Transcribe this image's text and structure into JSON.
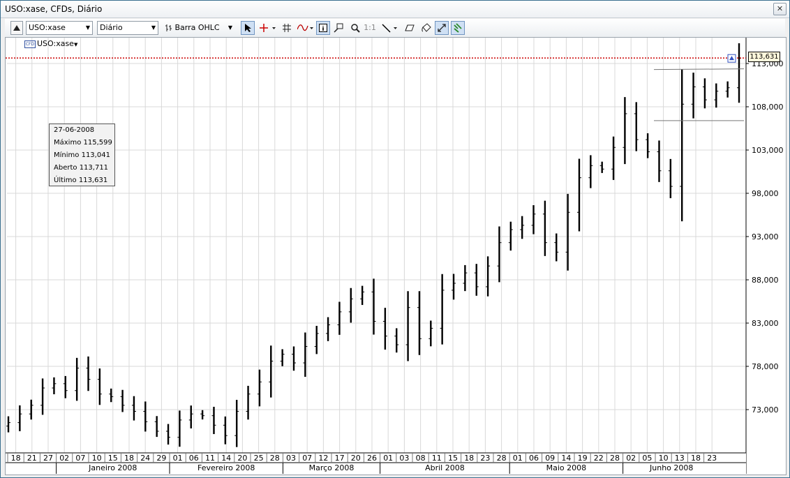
{
  "window": {
    "title": "USO:xase, CFDs, Diário",
    "close_glyph": "✕"
  },
  "toolbar": {
    "symbol_value": "USO:xase",
    "period_value": "Diário",
    "chart_type_value": "Barra OHLC",
    "zoom_ratio_label": "1:1",
    "icons": [
      "panel-toggle-icon",
      "bar-chart-icon",
      "cursor-icon",
      "crosshair-icon",
      "grid-icon",
      "indicator-icon",
      "info-icon",
      "zoom-box-icon",
      "zoom-icon",
      "line-tool-icon",
      "eraser-icon",
      "paint-icon",
      "auto-scale-icon",
      "link-icon"
    ]
  },
  "symbol_label": {
    "badge": "CFD",
    "text": "USO:xase"
  },
  "tooltip": {
    "date": "27-06-2008",
    "rows": [
      {
        "label": "Máximo",
        "value": "115,599"
      },
      {
        "label": "Mínimo",
        "value": "113,041"
      },
      {
        "label": "Aberto",
        "value": "113,711"
      },
      {
        "label": "Último",
        "value": "113,631"
      }
    ]
  },
  "price_tag": "113,631",
  "colors": {
    "bars": "#000000",
    "grid": "#d8d8d8",
    "price_line": "#cc0000",
    "tag_bg": "#fff8dc"
  },
  "chart_data": {
    "type": "ohlc",
    "title": "",
    "ylim": [
      68000,
      117000
    ],
    "y_ticks": [
      "73,000",
      "78,000",
      "83,000",
      "88,000",
      "93,000",
      "98,000",
      "103,000",
      "108,000",
      "113,000"
    ],
    "y_tick_values": [
      73000,
      78000,
      83000,
      88000,
      93000,
      98000,
      103000,
      108000,
      113000
    ],
    "last_price": 113631,
    "day_labels": [
      "18",
      "21",
      "27",
      "02",
      "07",
      "10",
      "15",
      "18",
      "24",
      "29",
      "01",
      "06",
      "11",
      "14",
      "20",
      "25",
      "28",
      "03",
      "07",
      "12",
      "17",
      "20",
      "26",
      "01",
      "03",
      "08",
      "11",
      "15",
      "18",
      "23",
      "28",
      "01",
      "06",
      "09",
      "14",
      "19",
      "22",
      "28",
      "02",
      "05",
      "10",
      "13",
      "18",
      "23"
    ],
    "months": [
      {
        "name": "Janeiro 2008",
        "start": 3,
        "end": 10
      },
      {
        "name": "Fevereiro 2008",
        "start": 10,
        "end": 17
      },
      {
        "name": "Março 2008",
        "start": 17,
        "end": 23
      },
      {
        "name": "Abril 2008",
        "start": 23,
        "end": 31
      },
      {
        "name": "Maio 2008",
        "start": 31,
        "end": 38
      },
      {
        "name": "Junho 2008",
        "start": 38,
        "end": 44
      }
    ],
    "close_series": [
      71.5,
      72.5,
      73.5,
      75.5,
      76,
      75.2,
      77.8,
      76.5,
      74.8,
      74.5,
      73.5,
      72.8,
      71.6,
      70.5,
      69.8,
      71.8,
      72.5,
      72.3,
      71.2,
      70,
      72.8,
      74.8,
      76.2,
      78.6,
      79.4,
      78.4,
      80.3,
      81.8,
      82.8,
      84.3,
      85.8,
      86.6,
      83.2,
      81.5,
      80.5,
      84.8,
      81.2,
      82.4,
      86.8,
      87.6,
      88.8,
      87.2,
      89.6,
      92.3,
      93.8,
      94.3,
      95.6,
      92.3,
      91.2,
      95.8,
      99.8,
      101.2,
      100.8,
      103.3,
      107.2,
      104.2,
      102.8,
      100.6,
      98.8,
      108.3,
      110.3,
      108.8,
      109.8,
      110.2,
      113.6
    ],
    "annotation_band": {
      "from": "03-06-2008",
      "top": 112.3,
      "bottom": 106.4
    }
  }
}
